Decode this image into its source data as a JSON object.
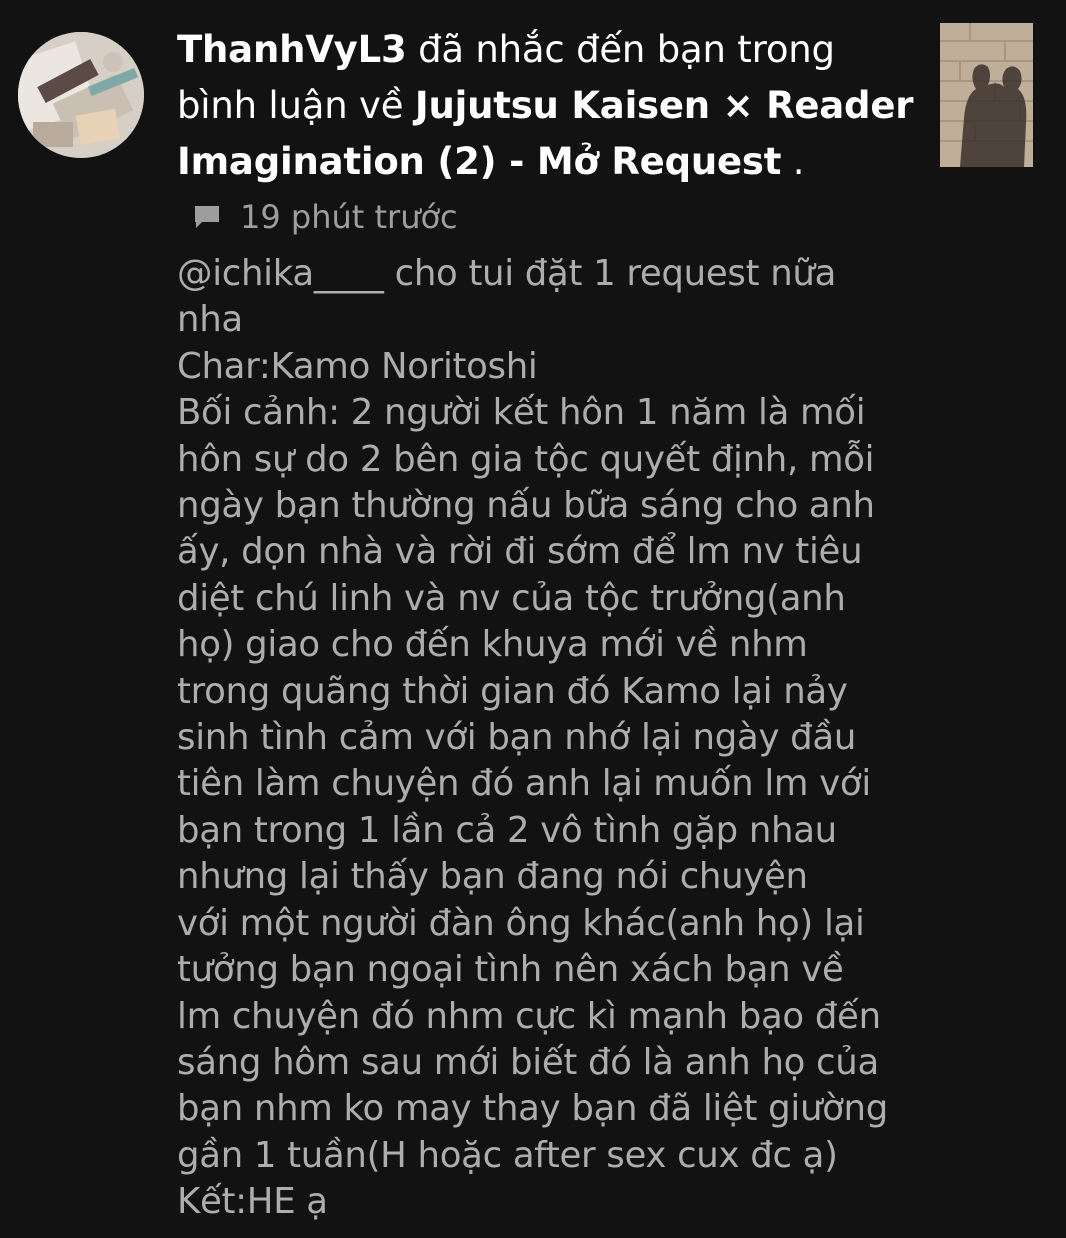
{
  "notification": {
    "user": "ThanhVyL3",
    "action_text": " đã nhắc đến bạn trong bình luận về ",
    "story_title": "Jujutsu Kaisen × Reader Imagination (2) - Mở Request",
    "trailing": " .",
    "time": "19 phút trước",
    "icons": {
      "avatar": "avatar-image",
      "meta": "comment-icon",
      "thumbnail": "story-cover-thumbnail"
    },
    "comment_lines": [
      "@ichika____ cho tui đặt 1 request nữa",
      "nha",
      "Char:Kamo Noritoshi",
      "Bối cảnh: 2 người kết hôn 1 năm là mối",
      "hôn sự do 2 bên gia tộc quyết định, mỗi",
      "ngày bạn thường nấu bữa sáng cho anh",
      "ấy, dọn nhà và rời đi sớm để lm nv tiêu",
      "diệt chú linh và nv của tộc trưởng(anh",
      "họ) giao cho đến khuya mới về nhm",
      "trong quãng thời gian đó Kamo lại nảy",
      "sinh tình cảm với bạn nhớ lại ngày đầu",
      "tiên làm chuyện đó anh lại muốn lm với",
      "bạn trong 1 lần cả 2 vô tình gặp nhau",
      "nhưng lại thấy bạn đang nói chuyện",
      "với một người đàn ông khác(anh họ) lại",
      "tưởng bạn ngoại tình nên xách bạn về",
      "lm chuyện đó nhm cực kì mạnh bạo đến",
      "sáng hôm sau mới biết đó là anh họ của",
      "bạn nhm ko may thay bạn đã liệt giường",
      "gần 1 tuần(H hoặc after sex cux đc ạ)",
      "Kết:HE ạ"
    ]
  },
  "colors": {
    "background": "#121212",
    "headline": "#ffffff",
    "meta": "#9e9e9e",
    "comment": "#adadad"
  }
}
